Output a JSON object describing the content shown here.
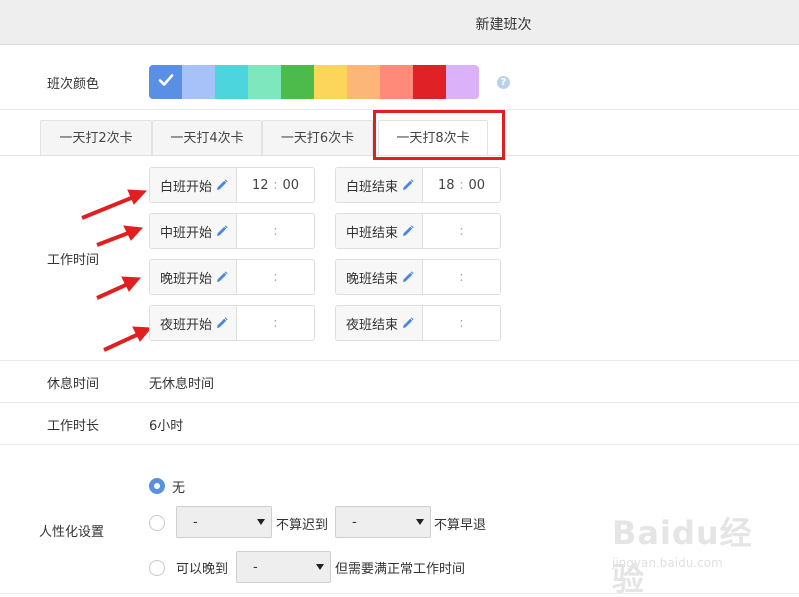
{
  "header": {
    "title": "新建班次"
  },
  "shift_color": {
    "label": "班次颜色",
    "swatches": [
      "#5a8fe6",
      "#a7c2f8",
      "#4dd5dd",
      "#7fe7be",
      "#4dbb4b",
      "#fcd65a",
      "#fcb677",
      "#ff8a7a",
      "#e02126",
      "#dbb2f9"
    ],
    "selected_index": 0,
    "help_icon": "question-circle-icon"
  },
  "tabs": [
    {
      "label": "一天打2次卡"
    },
    {
      "label": "一天打4次卡"
    },
    {
      "label": "一天打6次卡"
    },
    {
      "label": "一天打8次卡"
    }
  ],
  "active_tab_index": 3,
  "work_time": {
    "label": "工作时间",
    "start": [
      {
        "label": "白班开始",
        "hour": "12",
        "minute": "00"
      },
      {
        "label": "中班开始",
        "hour": "",
        "minute": ""
      },
      {
        "label": "晚班开始",
        "hour": "",
        "minute": ""
      },
      {
        "label": "夜班开始",
        "hour": "",
        "minute": ""
      }
    ],
    "end": [
      {
        "label": "白班结束",
        "hour": "18",
        "minute": "00"
      },
      {
        "label": "中班结束",
        "hour": "",
        "minute": ""
      },
      {
        "label": "晚班结束",
        "hour": "",
        "minute": ""
      },
      {
        "label": "夜班结束",
        "hour": "",
        "minute": ""
      }
    ],
    "separator": ":"
  },
  "rest_time": {
    "label": "休息时间",
    "value": "无休息时间"
  },
  "work_duration": {
    "label": "工作时长",
    "value": "6小时"
  },
  "humanize": {
    "label": "人性化设置",
    "option_none": "无",
    "late_select_value": "-",
    "not_late_text": "不算迟到",
    "early_select_value": "-",
    "not_early_text": "不算早退",
    "can_late_text": "可以晚到",
    "can_late_select_value": "-",
    "full_time_text": "但需要满正常工作时间",
    "selected_option": 0
  },
  "watermark": {
    "logo": "Baidu经验",
    "url": "jingyan.baidu.com"
  },
  "colors": {
    "accent": "#5a8fe6",
    "annotation_red": "#e02020"
  }
}
